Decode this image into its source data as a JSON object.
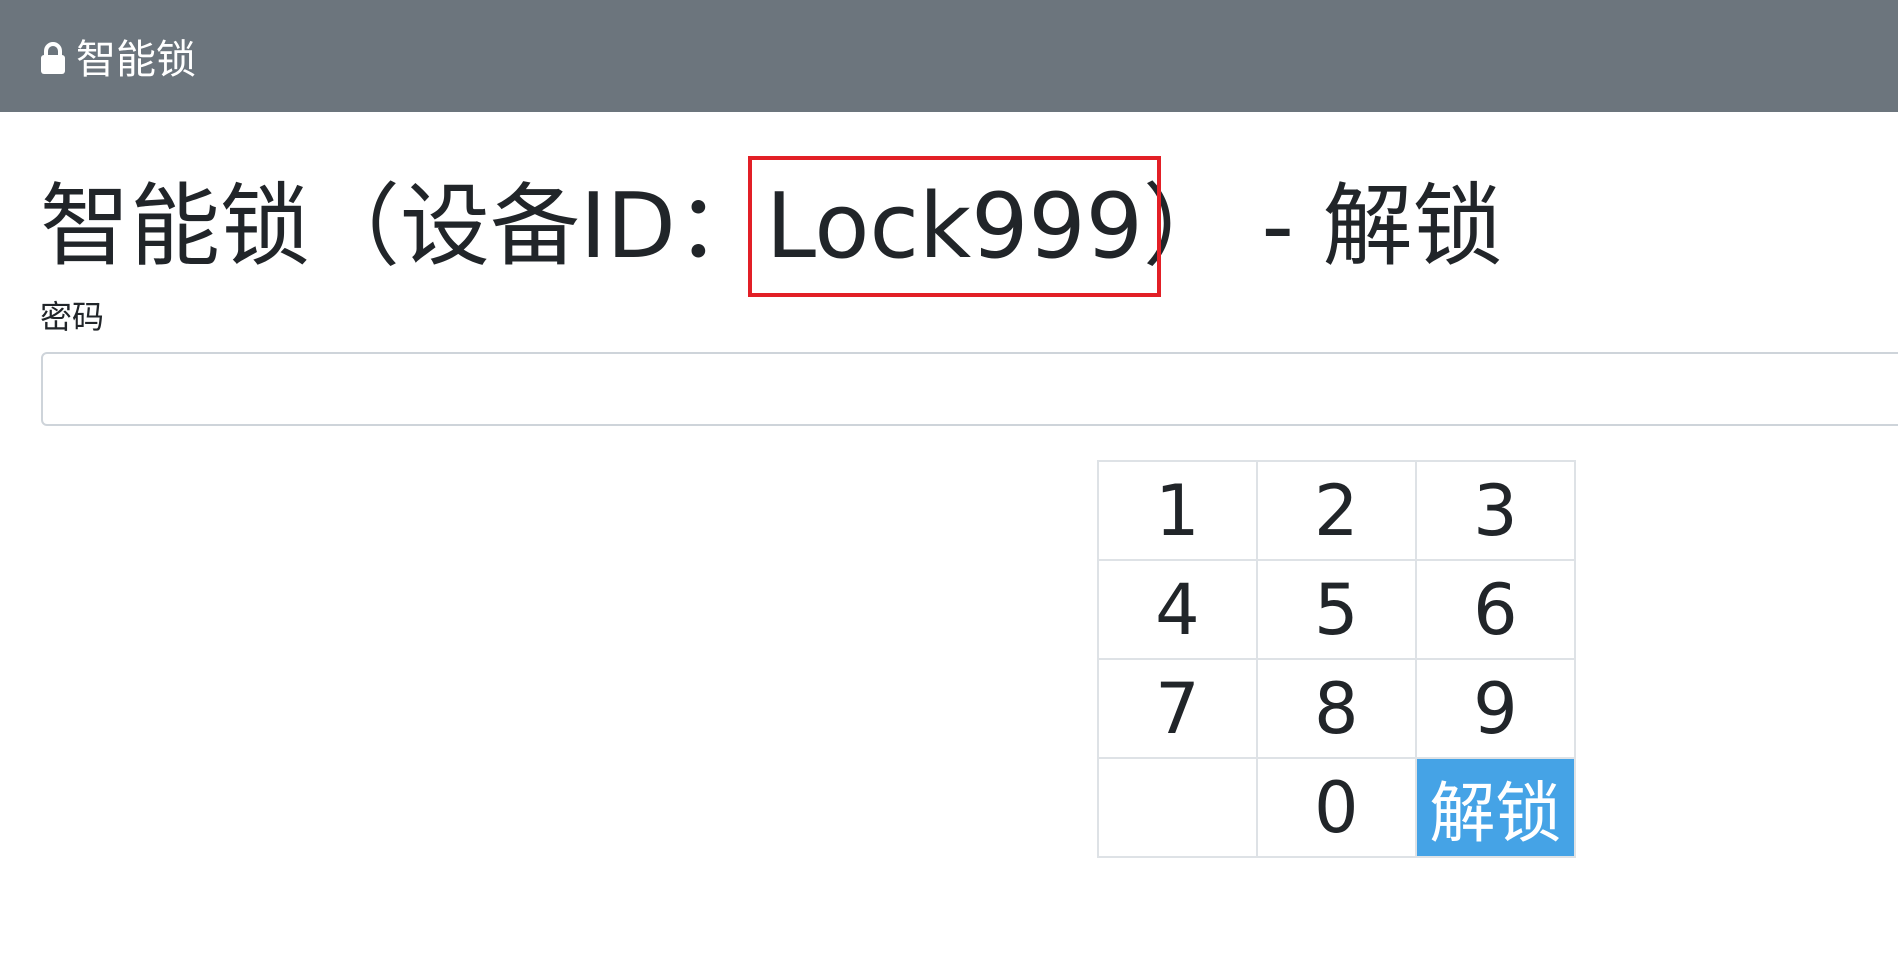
{
  "navbar": {
    "brand": "智能锁",
    "brand_icon": "lock-icon",
    "background": "#6c757d"
  },
  "title": {
    "prefix": "智能锁（设备ID：",
    "device_id": "Lock999",
    "suffix": "）  - 解锁",
    "highlight_color": "#e21f26"
  },
  "form": {
    "password_label": "密码",
    "password_value": "",
    "password_placeholder": ""
  },
  "keypad": {
    "rows": [
      [
        "1",
        "2",
        "3"
      ],
      [
        "4",
        "5",
        "6"
      ],
      [
        "7",
        "8",
        "9"
      ],
      [
        "",
        "0",
        "解锁"
      ]
    ],
    "unlock_color": "#45a3e6"
  }
}
